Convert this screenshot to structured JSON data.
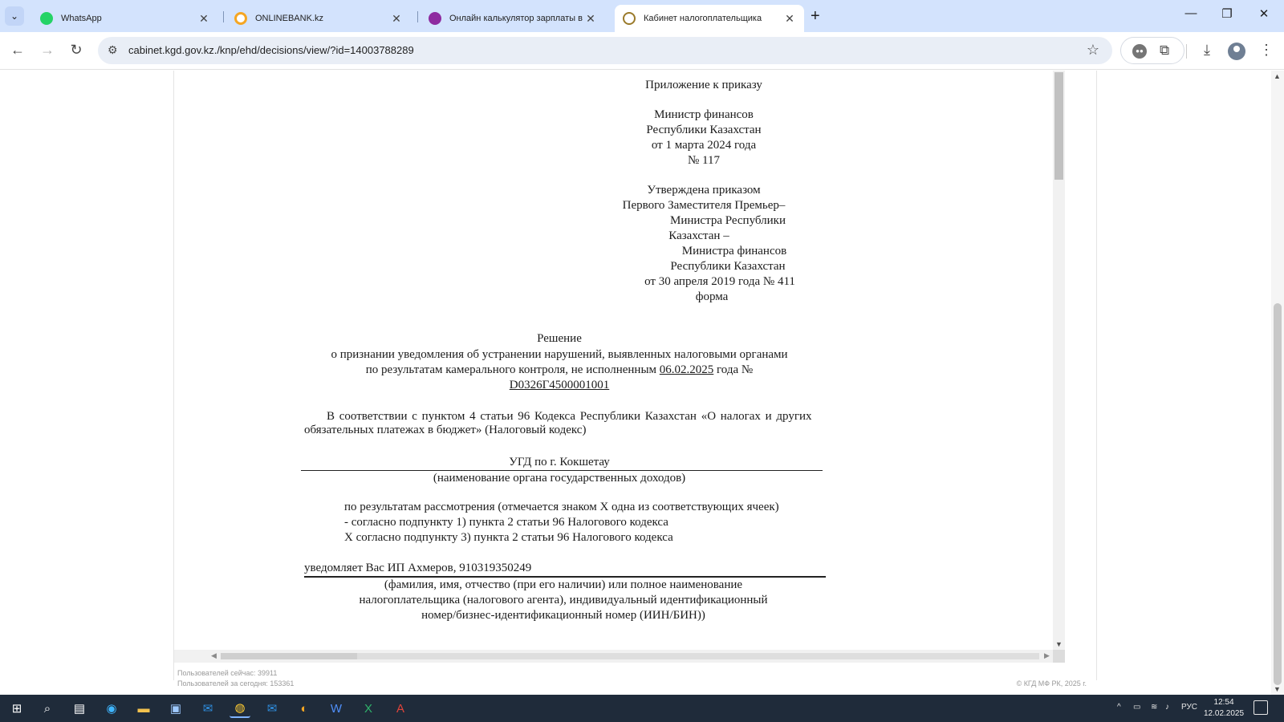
{
  "browser": {
    "tabs": [
      {
        "title": "WhatsApp",
        "favicon_color": "#25d366",
        "active": false
      },
      {
        "title": "ONLINEBANK.kz",
        "favicon_color": "#f5a623",
        "active": false
      },
      {
        "title": "Онлайн калькулятор зарплаты в Каз",
        "favicon_color": "#8e2ba0",
        "active": false
      },
      {
        "title": "Кабинет налогоплательщика",
        "favicon_color": "#9a7a2a",
        "active": true
      }
    ],
    "url": "cabinet.kgd.gov.kz./knp/ehd/decisions/view/?id=14003788289"
  },
  "document": {
    "appendix": "Приложение к приказу",
    "minister_block": [
      "Министр финансов",
      "Республики Казахстан",
      "от 1 марта 2024 года",
      "№ 117"
    ],
    "approved_block": [
      "Утверждена приказом",
      "Первого Заместителя Премьер–",
      "Министра Республики",
      "Казахстан –",
      "Министра финансов",
      "Республики Казахстан",
      "от 30 апреля 2019 года № 411",
      "форма"
    ],
    "title": "Решение",
    "subtitle_line1": "о признании уведомления об устранении нарушений, выявленных налоговыми органами",
    "subtitle_line2_prefix": "по результатам камерального контроля, не исполненным",
    "subtitle_date": "06.02.2025",
    "subtitle_line2_suffix": "года №",
    "notice_number": "D0326Г4500001001",
    "basis_line1": "В соответствии с пунктом 4 статьи 96 Кодекса Республики Казахстан «О налогах и других",
    "basis_line2": "обязательных платежах в бюджет» (Налоговый кодекс)",
    "authority": "УГД по г. Кокшетау",
    "authority_caption": "(наименование органа государственных доходов)",
    "review_intro": "по результатам рассмотрения (отмечается знаком Х одна из соответствующих ячеек)",
    "review_option1": "- согласно подпункту 1) пункта 2 статьи 96 Налогового кодекса",
    "review_option2": "Х согласно подпункту 3) пункта 2 статьи 96 Налогового кодекса",
    "notifies": "уведомляет Вас ИП Ахмеров, 910319350249",
    "taxpayer_caption": [
      "(фамилия, имя, отчество (при его наличии) или полное наименование",
      "налогоплательщика (налогового агента), индивидуальный идентификационный",
      "номер/бизнес-идентификационный номер (ИИН/БИН))"
    ]
  },
  "footer": {
    "users_now": "Пользователей сейчас: 39911",
    "users_today": "Пользователей за сегодня: 153361",
    "copyright": "© КГД МФ РК, 2025 г."
  },
  "taskbar": {
    "language": "РУС",
    "time": "12:54",
    "date": "12.02.2025"
  }
}
